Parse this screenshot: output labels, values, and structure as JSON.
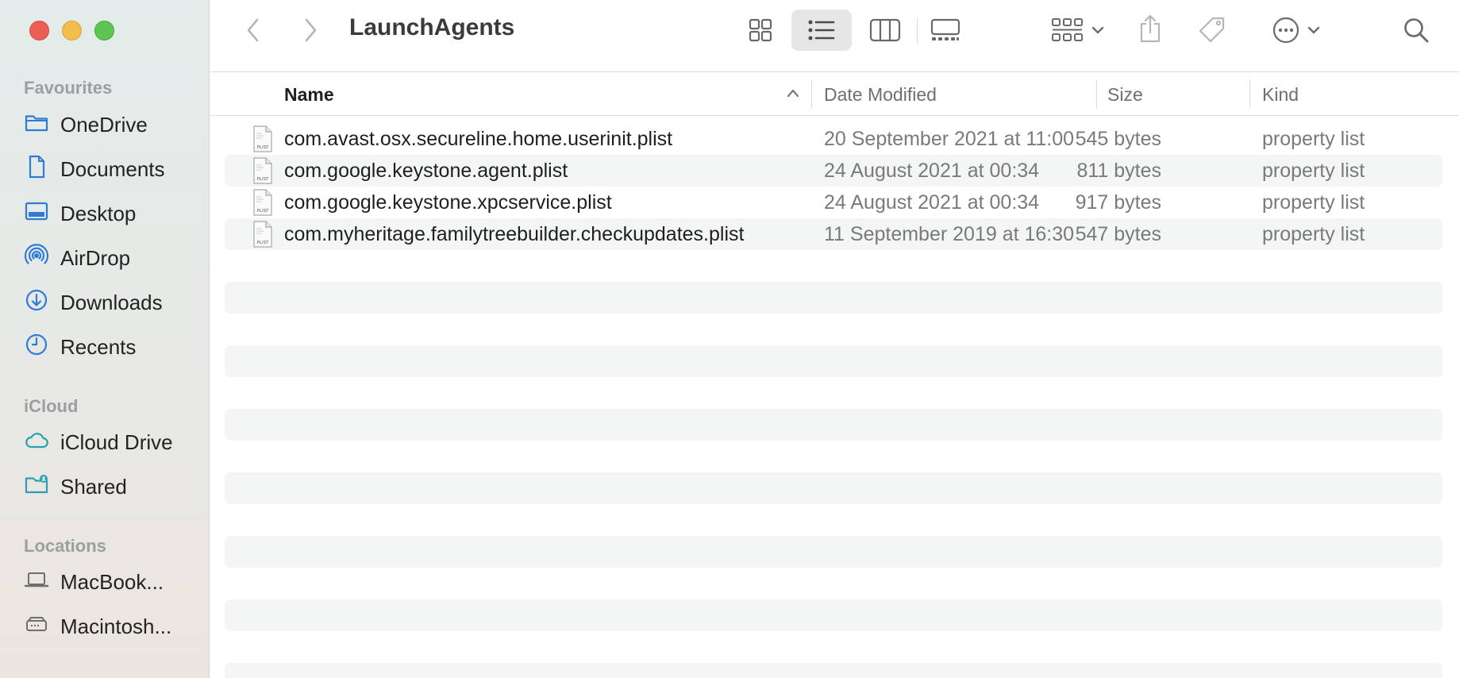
{
  "window": {
    "title": "LaunchAgents"
  },
  "sidebar": {
    "favourites_heading": "Favourites",
    "favourites": [
      {
        "label": "OneDrive",
        "icon": "folder-icon"
      },
      {
        "label": "Documents",
        "icon": "document-icon"
      },
      {
        "label": "Desktop",
        "icon": "desktop-icon"
      },
      {
        "label": "AirDrop",
        "icon": "airdrop-icon"
      },
      {
        "label": "Downloads",
        "icon": "downloads-icon"
      },
      {
        "label": "Recents",
        "icon": "clock-icon"
      }
    ],
    "icloud_heading": "iCloud",
    "icloud": [
      {
        "label": "iCloud Drive",
        "icon": "cloud-icon"
      },
      {
        "label": "Shared",
        "icon": "shared-folder-icon"
      }
    ],
    "locations_heading": "Locations",
    "locations": [
      {
        "label": "MacBook...",
        "icon": "laptop-icon"
      },
      {
        "label": "Macintosh...",
        "icon": "drive-icon"
      }
    ]
  },
  "columns": {
    "name": "Name",
    "date_modified": "Date Modified",
    "size": "Size",
    "kind": "Kind",
    "sort_indicator": "ascending"
  },
  "files": [
    {
      "name": "com.avast.osx.secureline.home.userinit.plist",
      "date": "20 September 2021 at 11:00",
      "size": "545 bytes",
      "kind": "property list",
      "icon_text": "PLIST"
    },
    {
      "name": "com.google.keystone.agent.plist",
      "date": "24 August 2021 at 00:34",
      "size": "811 bytes",
      "kind": "property list",
      "icon_text": "PLIST"
    },
    {
      "name": "com.google.keystone.xpcservice.plist",
      "date": "24 August 2021 at 00:34",
      "size": "917 bytes",
      "kind": "property list",
      "icon_text": "PLIST"
    },
    {
      "name": "com.myheritage.familytreebuilder.checkupdates.plist",
      "date": "11 September 2019 at 16:30",
      "size": "547 bytes",
      "kind": "property list",
      "icon_text": "PLIST"
    }
  ],
  "colors": {
    "accent_icon": "#2f7bd8",
    "traffic_close": "#ec5f57",
    "traffic_minimize": "#f4be4f",
    "traffic_maximize": "#5fc552"
  }
}
